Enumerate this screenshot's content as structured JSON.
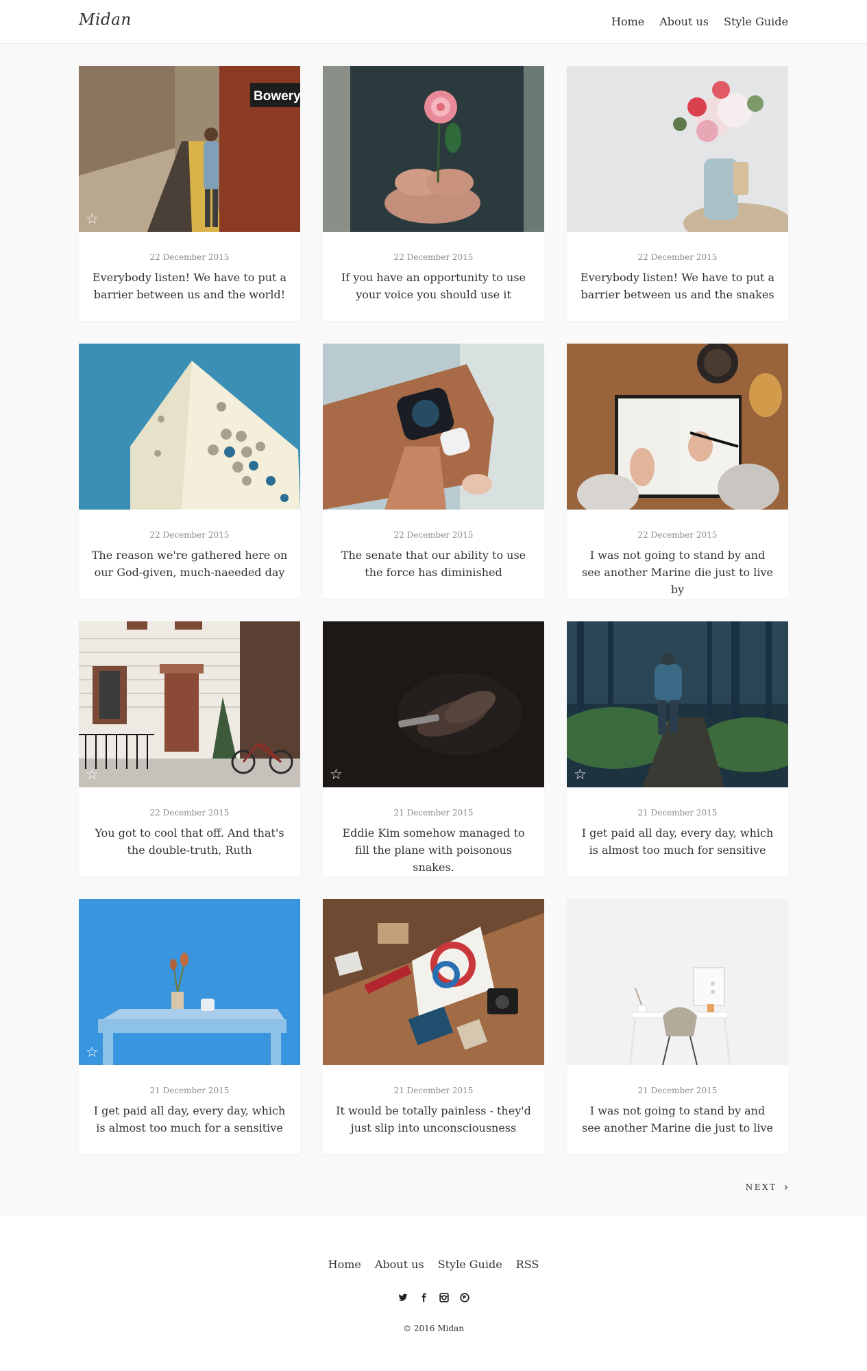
{
  "header": {
    "logo": "Midan",
    "nav": [
      "Home",
      "About us",
      "Style Guide"
    ]
  },
  "posts": [
    {
      "date": "22 December 2015",
      "title": "Everybody listen! We have to put a barrier between us and the world!",
      "image": "subway-station",
      "starred": true
    },
    {
      "date": "22 December 2015",
      "title": "If you have an opportunity to use your voice you should use it",
      "image": "hands-holding-rose",
      "starred": false
    },
    {
      "date": "22 December 2015",
      "title": "Everybody listen! We have to put a barrier between us and the snakes",
      "image": "flowers-in-jug",
      "starred": false
    },
    {
      "date": "22 December 2015",
      "title": "The reason we're gathered here on our God-given, much-naeeded day",
      "image": "white-building-blue-sky",
      "starred": false
    },
    {
      "date": "22 December 2015",
      "title": "The senate that our ability to use the force has diminished",
      "image": "smartwatch-wrist",
      "starred": false
    },
    {
      "date": "22 December 2015",
      "title": "I was not going to stand by and see another Marine die just to live by",
      "image": "writing-notebook",
      "starred": false
    },
    {
      "date": "22 December 2015",
      "title": "You got to cool that off. And that's the double-truth, Ruth",
      "image": "brownstone-door-bicycle",
      "starred": true
    },
    {
      "date": "21 December 2015",
      "title": "Eddie Kim somehow managed to fill the plane with poisonous snakes.",
      "image": "phone-in-dark",
      "starred": true
    },
    {
      "date": "21 December 2015",
      "title": "I get paid all day, every day, which is almost too much for sensitive",
      "image": "hiker-in-forest",
      "starred": true
    },
    {
      "date": "21 December 2015",
      "title": "I get paid all day, every day, which is almost too much for a sensitive",
      "image": "blue-table-plant",
      "starred": true
    },
    {
      "date": "21 December 2015",
      "title": "It would be totally painless - they'd just slip into unconsciousness",
      "image": "desk-items-flatlay",
      "starred": false
    },
    {
      "date": "21 December 2015",
      "title": "I was not going to stand by and see another Marine die just to live",
      "image": "white-desk-chair",
      "starred": false
    }
  ],
  "pagination": {
    "next_label": "NEXT",
    "next_icon": "chevron-right-icon"
  },
  "footer": {
    "nav": [
      "Home",
      "About us",
      "Style Guide",
      "RSS"
    ],
    "social": [
      "twitter-icon",
      "facebook-icon",
      "instagram-icon",
      "pinterest-icon"
    ],
    "copyright": "© 2016 Midan"
  },
  "colors": {
    "background": "#f9f9f9",
    "card": "#ffffff",
    "text": "#333333",
    "muted": "#888888"
  }
}
